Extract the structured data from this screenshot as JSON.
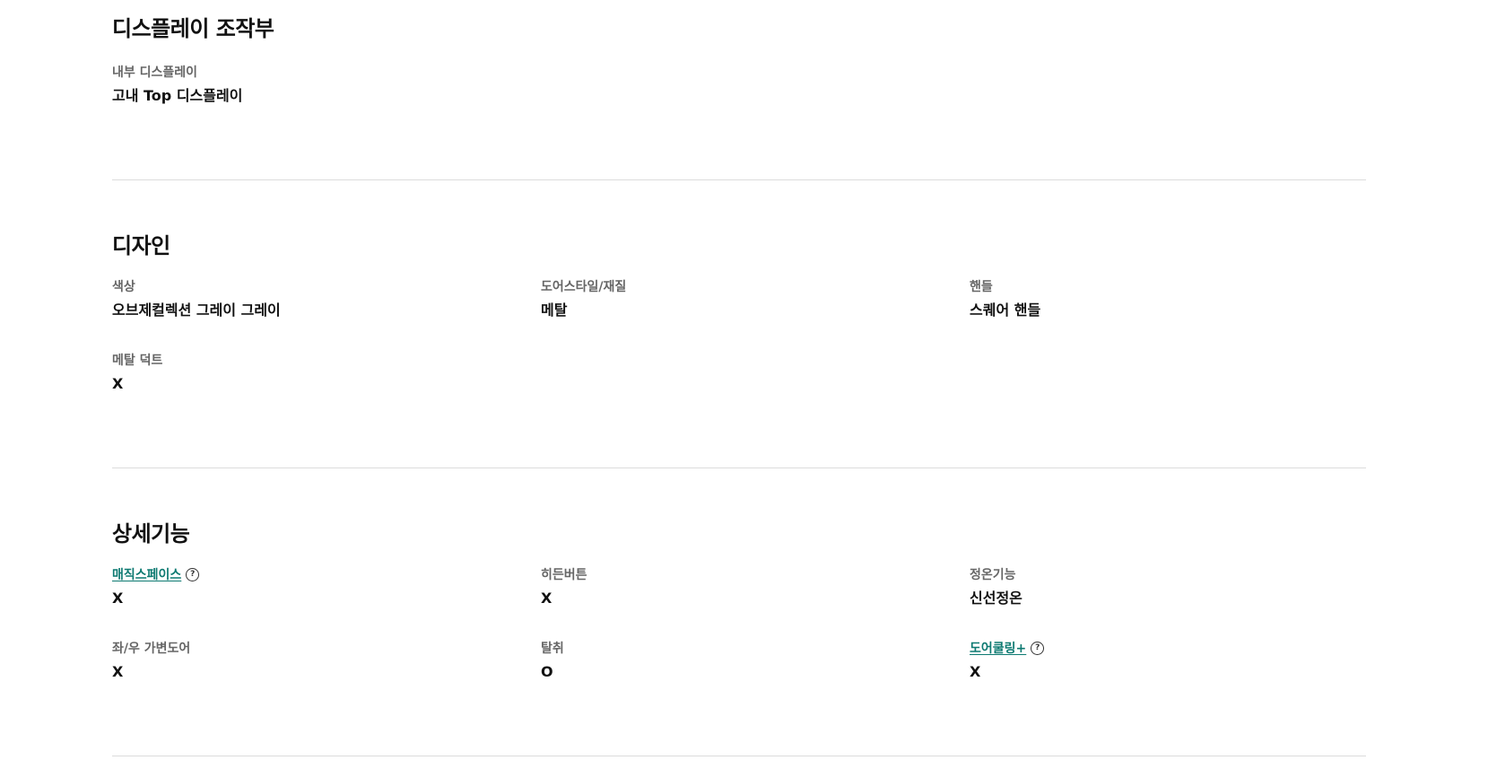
{
  "sections": [
    {
      "title": "디스플레이 조작부",
      "items": [
        {
          "label": "내부 디스플레이",
          "value": "고내 Top 디스플레이"
        }
      ]
    },
    {
      "title": "디자인",
      "items": [
        {
          "label": "색상",
          "value": "오브제컬렉션 그레이 그레이"
        },
        {
          "label": "도어스타일/재질",
          "value": "메탈"
        },
        {
          "label": "핸들",
          "value": "스퀘어 핸들"
        },
        {
          "label": "메탈 덕트",
          "value": "X"
        }
      ]
    },
    {
      "title": "상세기능",
      "items": [
        {
          "label": "매직스페이스",
          "value": "X",
          "help_icon": "question-circle"
        },
        {
          "label": "히든버튼",
          "value": "X"
        },
        {
          "label": "정온기능",
          "value": "신선정온"
        },
        {
          "label": "좌/우 가변도어",
          "value": "X"
        },
        {
          "label": "탈취",
          "value": "O"
        },
        {
          "label": "도어쿨링+",
          "value": "X",
          "help_icon": "question-circle"
        }
      ]
    }
  ],
  "colors": {
    "link": "#0e7a72",
    "label": "#666666",
    "value": "#111111",
    "divider": "#dcdcdc"
  }
}
